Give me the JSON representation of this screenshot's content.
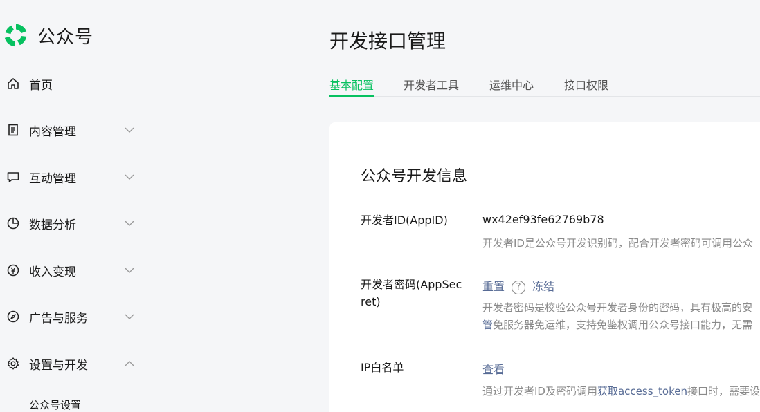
{
  "app": {
    "name": "公众号",
    "brand_color": "#07c160"
  },
  "sidebar": {
    "items": [
      {
        "label": "首页",
        "icon": "home-icon",
        "expandable": false
      },
      {
        "label": "内容管理",
        "icon": "document-icon",
        "expandable": true,
        "expanded": false
      },
      {
        "label": "互动管理",
        "icon": "chat-icon",
        "expandable": true,
        "expanded": false
      },
      {
        "label": "数据分析",
        "icon": "pie-chart-icon",
        "expandable": true,
        "expanded": false
      },
      {
        "label": "收入变现",
        "icon": "yen-icon",
        "expandable": true,
        "expanded": false
      },
      {
        "label": "广告与服务",
        "icon": "compass-icon",
        "expandable": true,
        "expanded": false
      },
      {
        "label": "设置与开发",
        "icon": "gear-icon",
        "expandable": true,
        "expanded": true
      }
    ],
    "sub_items": [
      {
        "label": "公众号设置"
      }
    ]
  },
  "main": {
    "title": "开发接口管理",
    "tabs": [
      {
        "label": "基本配置",
        "active": true
      },
      {
        "label": "开发者工具",
        "active": false
      },
      {
        "label": "运维中心",
        "active": false
      },
      {
        "label": "接口权限",
        "active": false
      }
    ],
    "section_title": "公众号开发信息",
    "rows": {
      "appid": {
        "label": "开发者ID(AppID)",
        "value": "wx42ef93fe62769b78",
        "desc": "开发者ID是公众号开发识别码，配合开发者密码可调用公众"
      },
      "secret": {
        "label_line1": "开发者密码(AppSec",
        "label_line2": "ret)",
        "reset": "重置",
        "help": "?",
        "freeze": "冻结",
        "desc_line1": "开发者密码是校验公众号开发者身份的密码，具有极高的安",
        "desc_line2_link": "管",
        "desc_line2_rest": "免服务器免运维，支持免鉴权调用公众号接口能力，无需"
      },
      "ip": {
        "label": "IP白名单",
        "view": "查看",
        "desc_pre": "通过开发者ID及密码调用",
        "desc_link": "获取access_token",
        "desc_post": "接口时，需要设"
      }
    }
  },
  "colors": {
    "accent": "#07c160",
    "link": "#576b95",
    "muted": "#8a8a8a"
  }
}
